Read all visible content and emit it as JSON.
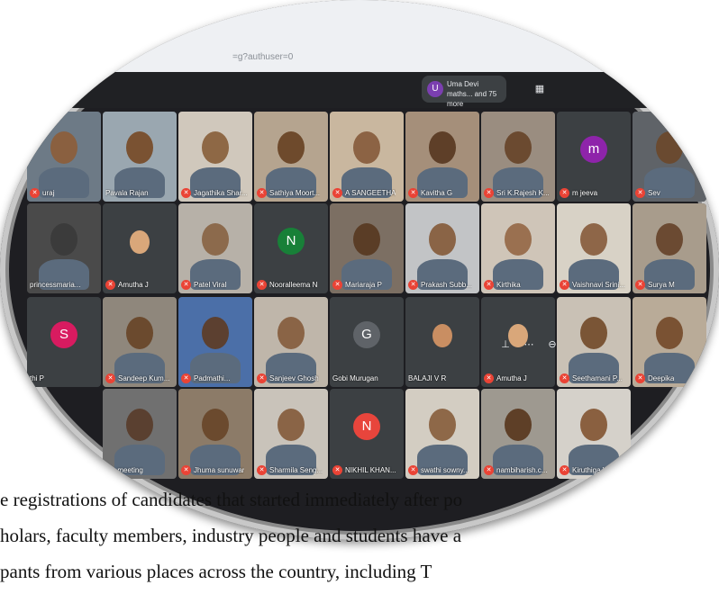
{
  "browser": {
    "url_fragment": "=g?authuser=0"
  },
  "meet": {
    "people_chip": {
      "avatar_initial": "U",
      "text": "Uma Devi maths... and 75 more"
    },
    "participants": [
      {
        "name": "uraj",
        "mic_off": true,
        "kind": "camera",
        "skin": "#8a6040",
        "bg": "#6d7a86"
      },
      {
        "name": "Pavala Rajan",
        "mic_off": false,
        "kind": "camera",
        "skin": "#7a5232",
        "bg": "#9aa7b0"
      },
      {
        "name": "Jagathika Shar...",
        "mic_off": true,
        "kind": "camera",
        "skin": "#8e6845",
        "bg": "#d0c8bc"
      },
      {
        "name": "Sathiya Moort...",
        "mic_off": true,
        "kind": "camera",
        "skin": "#6e4a2c",
        "bg": "#b5a48f"
      },
      {
        "name": "A SANGEETHA",
        "mic_off": true,
        "kind": "camera",
        "skin": "#8c6344",
        "bg": "#c9b79f"
      },
      {
        "name": "Kavitha G",
        "mic_off": true,
        "kind": "camera",
        "skin": "#5e3f28",
        "bg": "#a58f7a"
      },
      {
        "name": "Sri K.Rajesh K...",
        "mic_off": true,
        "kind": "camera",
        "skin": "#6b4a30",
        "bg": "#9a8d80"
      },
      {
        "name": "m jeeva",
        "mic_off": true,
        "kind": "avatar",
        "initial": "m",
        "color": "#8e24aa"
      },
      {
        "name": "Sev",
        "mic_off": true,
        "kind": "camera",
        "skin": "#6a4a30",
        "bg": "#5f6368"
      },
      {
        "name": "princessmaria...",
        "mic_off": false,
        "kind": "camera",
        "skin": "#3b3b3b",
        "bg": "#4a4a4a"
      },
      {
        "name": "Amutha J",
        "mic_off": true,
        "kind": "photo",
        "skin": "#d9a77a",
        "bg": "#3c4043"
      },
      {
        "name": "Patel Viral",
        "mic_off": true,
        "kind": "camera",
        "skin": "#8c6a4c",
        "bg": "#b7b1a8"
      },
      {
        "name": "Nooralleema N",
        "mic_off": true,
        "kind": "avatar",
        "initial": "N",
        "color": "#188038"
      },
      {
        "name": "Mariaraja P",
        "mic_off": true,
        "kind": "camera",
        "skin": "#5a3d26",
        "bg": "#7c6f63"
      },
      {
        "name": "Prakash Subb...",
        "mic_off": true,
        "kind": "camera",
        "skin": "#8a6446",
        "bg": "#c2c4c6"
      },
      {
        "name": "Kirthika",
        "mic_off": true,
        "kind": "camera",
        "skin": "#9a7050",
        "bg": "#cfc5b8"
      },
      {
        "name": "Vaishnavi Srini...",
        "mic_off": true,
        "kind": "camera",
        "skin": "#8e6648",
        "bg": "#d8d2c6"
      },
      {
        "name": "Surya M",
        "mic_off": true,
        "kind": "camera",
        "skin": "#6b4a32",
        "bg": "#a89c8c"
      },
      {
        "name": "thi P",
        "mic_off": false,
        "kind": "avatar",
        "initial": "S",
        "color": "#d81b60"
      },
      {
        "name": "Sandeep Kum...",
        "mic_off": true,
        "kind": "camera",
        "skin": "#6b4a2e",
        "bg": "#8f877c"
      },
      {
        "name": "Padmathi...",
        "mic_off": true,
        "kind": "camera",
        "skin": "#5c4030",
        "bg": "#4b6fa8"
      },
      {
        "name": "Sanjeev Ghosh",
        "mic_off": true,
        "kind": "camera",
        "skin": "#8a6446",
        "bg": "#bfb6aa"
      },
      {
        "name": "Gobi Murugan",
        "mic_off": false,
        "kind": "avatar",
        "initial": "G",
        "color": "#5f6368"
      },
      {
        "name": "BALAJI V R",
        "mic_off": false,
        "kind": "photo",
        "skin": "#c98e62",
        "bg": "#3c4043"
      },
      {
        "name": "Amutha J",
        "mic_off": true,
        "kind": "photo",
        "skin": "#d9a77a",
        "bg": "#3c4043"
      },
      {
        "name": "Seethamani P...",
        "mic_off": true,
        "kind": "camera",
        "skin": "#7a5536",
        "bg": "#c9c1b5"
      },
      {
        "name": "Deepika",
        "mic_off": true,
        "kind": "camera",
        "skin": "#7a5233",
        "bg": "#b9ab98"
      },
      {
        "name": "the meeting",
        "mic_off": false,
        "kind": "camera",
        "skin": "#5a4030",
        "bg": "#707070"
      },
      {
        "name": "Jhuma sunuwar",
        "mic_off": true,
        "kind": "camera",
        "skin": "#6b4a2e",
        "bg": "#8c7b68"
      },
      {
        "name": "Sharmila Seng...",
        "mic_off": true,
        "kind": "camera",
        "skin": "#8a6446",
        "bg": "#c9c3ba"
      },
      {
        "name": "NIKHIL KHAN...",
        "mic_off": true,
        "kind": "avatar",
        "initial": "N",
        "color": "#e8453c"
      },
      {
        "name": "swathi sowny...",
        "mic_off": true,
        "kind": "camera",
        "skin": "#8e6848",
        "bg": "#d3cdc2"
      },
      {
        "name": "nambiharish.c...",
        "mic_off": true,
        "kind": "camera",
        "skin": "#5e3f27",
        "bg": "#9e9990"
      },
      {
        "name": "Kiruthiga Vi...",
        "mic_off": true,
        "kind": "camera",
        "skin": "#8a6040",
        "bg": "#d5d1ca"
      }
    ]
  },
  "document": {
    "lines": [
      "e registrations of candidates that started immediately after po",
      "holars, faculty members, industry people and students have a",
      "pants from various places across the country, including T"
    ]
  }
}
